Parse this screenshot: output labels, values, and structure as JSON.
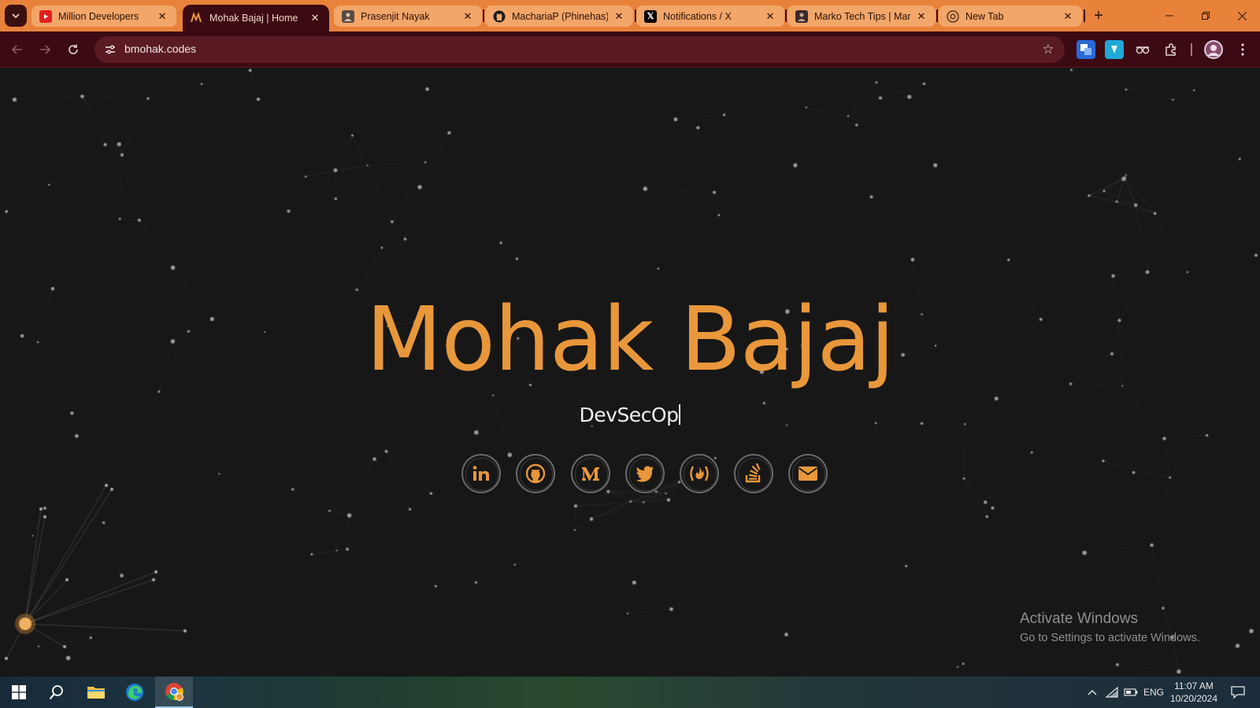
{
  "browser": {
    "tabs": [
      {
        "label": "Million Developers",
        "favicon": "youtube-icon",
        "active": false
      },
      {
        "label": "Mohak Bajaj | Home",
        "favicon": "mb-logo-icon",
        "active": true
      },
      {
        "label": "Prasenjit Nayak",
        "favicon": "avatar-icon",
        "active": false
      },
      {
        "label": "MachariaP (Phinehas)",
        "favicon": "github-icon",
        "active": false
      },
      {
        "label": "Notifications / X",
        "favicon": "x-icon",
        "active": false
      },
      {
        "label": "Marko Tech Tips | Marko",
        "favicon": "avatar-icon",
        "active": false
      },
      {
        "label": "New Tab",
        "favicon": "chrome-icon",
        "active": false
      }
    ],
    "new_tab_symbol": "+",
    "url": "bmohak.codes",
    "theme_color": "#e8823a",
    "toolbar_color": "#3c0a12"
  },
  "page": {
    "name": "Mohak Bajaj",
    "role_typed": "DevSecOp",
    "accent_color": "#e8973a",
    "background_color": "#171717",
    "social_links": [
      {
        "name": "linkedin",
        "icon": "linkedin-icon"
      },
      {
        "name": "github",
        "icon": "github-icon"
      },
      {
        "name": "medium",
        "icon": "medium-icon"
      },
      {
        "name": "twitter",
        "icon": "twitter-icon"
      },
      {
        "name": "freecodecamp",
        "icon": "freecodecamp-icon"
      },
      {
        "name": "stackoverflow",
        "icon": "stackoverflow-icon"
      },
      {
        "name": "email",
        "icon": "envelope-icon"
      }
    ]
  },
  "watermark": {
    "line1": "Activate Windows",
    "line2": "Go to Settings to activate Windows."
  },
  "taskbar": {
    "language": "ENG",
    "time": "11:07 AM",
    "date": "10/20/2024"
  }
}
